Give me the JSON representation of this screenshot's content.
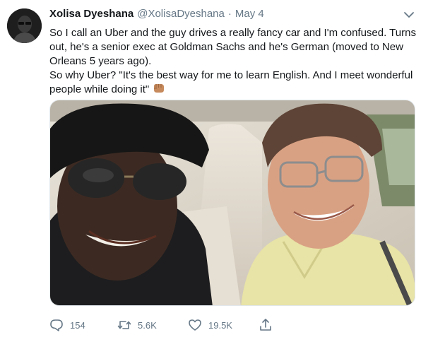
{
  "tweet": {
    "display_name": "Xolisa Dyeshana",
    "handle": "@XolisaDyeshana",
    "separator": "·",
    "date": "May 4",
    "lines": [
      "So I call an Uber and the guy drives a really fancy car and I'm confused. Turns out, he's a senior exec at Goldman Sachs and he's German (moved to New Orleans 5 years ago).",
      "So why Uber? \"It's the best way for me to learn English. And I meet wonderful people while doing it\""
    ],
    "emoji": "fisted-hand-medium-skin-tone",
    "media": {
      "description_icon": "photo"
    }
  },
  "actions": {
    "reply_count": "154",
    "retweet_count": "5.6K",
    "like_count": "19.5K"
  },
  "icons": {
    "reply": "reply-icon",
    "retweet": "retweet-icon",
    "like": "heart-icon",
    "share": "share-icon",
    "menu": "chevron-down-icon"
  },
  "colors": {
    "text": "#14171a",
    "muted": "#657786",
    "border": "#e1e8ed"
  }
}
